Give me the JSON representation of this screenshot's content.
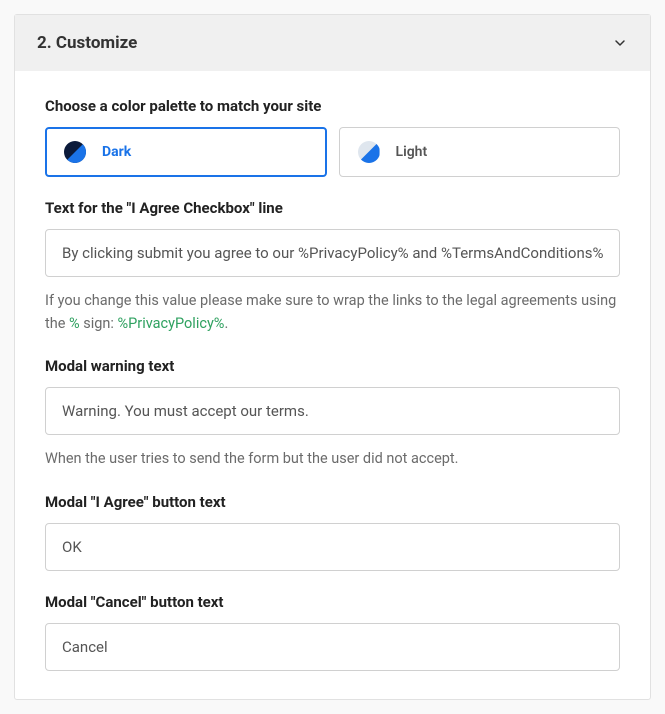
{
  "header": {
    "title": "2. Customize"
  },
  "palette": {
    "label": "Choose a color palette to match your site",
    "options": {
      "dark": "Dark",
      "light": "Light"
    }
  },
  "checkboxText": {
    "label": "Text for the \"I Agree Checkbox\" line",
    "value": "By clicking submit you agree to our %PrivacyPolicy% and %TermsAndConditions%",
    "helpPrefix": "If you change this value please make sure to wrap the links to the legal agreements using the ",
    "helpPercent": "%",
    "helpMid": " sign: ",
    "helpExample": "%PrivacyPolicy%",
    "helpSuffix": "."
  },
  "warningText": {
    "label": "Modal warning text",
    "value": "Warning. You must accept our terms.",
    "help": "When the user tries to send the form but the user did not accept."
  },
  "agreeButton": {
    "label": "Modal \"I Agree\" button text",
    "value": "OK"
  },
  "cancelButton": {
    "label": "Modal \"Cancel\" button text",
    "value": "Cancel"
  }
}
